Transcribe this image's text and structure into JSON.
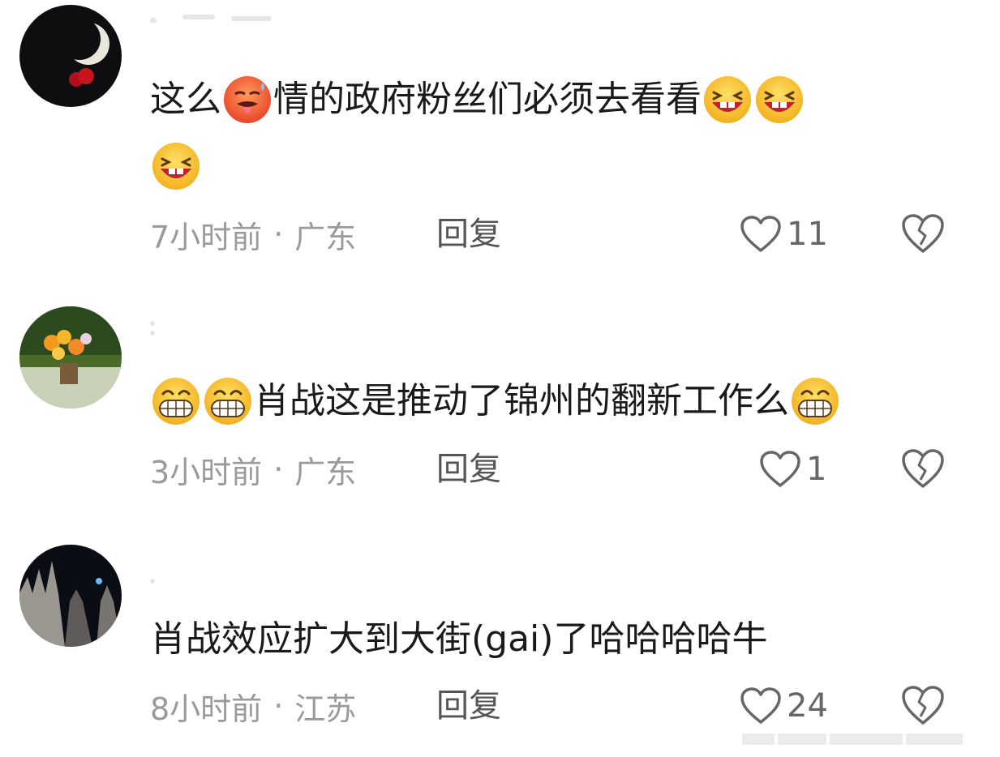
{
  "comments": [
    {
      "avatar_icon": "moon-rose-avatar",
      "text_line1_start": "这么",
      "text_line1_mid": "情的政府粉丝们必须去看看",
      "emoji_inline": "hot-face-emoji",
      "emoji_trailing": "laughing-emoji",
      "time": "7小时前",
      "location": "广东",
      "reply_label": "回复",
      "like_count": "11"
    },
    {
      "avatar_icon": "flowers-avatar",
      "text_line1": "肖战这是推动了锦州的翻新工作么",
      "emoji": "grinning-emoji",
      "time": "3小时前",
      "location": "广东",
      "reply_label": "回复",
      "like_count": "1"
    },
    {
      "avatar_icon": "cathedral-night-avatar",
      "text_line1": "肖战效应扩大到大街(gai)了哈哈哈哈牛",
      "time": "8小时前",
      "location": "江苏",
      "reply_label": "回复",
      "like_count": "24"
    }
  ],
  "separator": "·",
  "colors": {
    "meta_gray": "#9a9a9a",
    "text": "#1a1a1a",
    "emoji_yellow": "#f7c531"
  }
}
